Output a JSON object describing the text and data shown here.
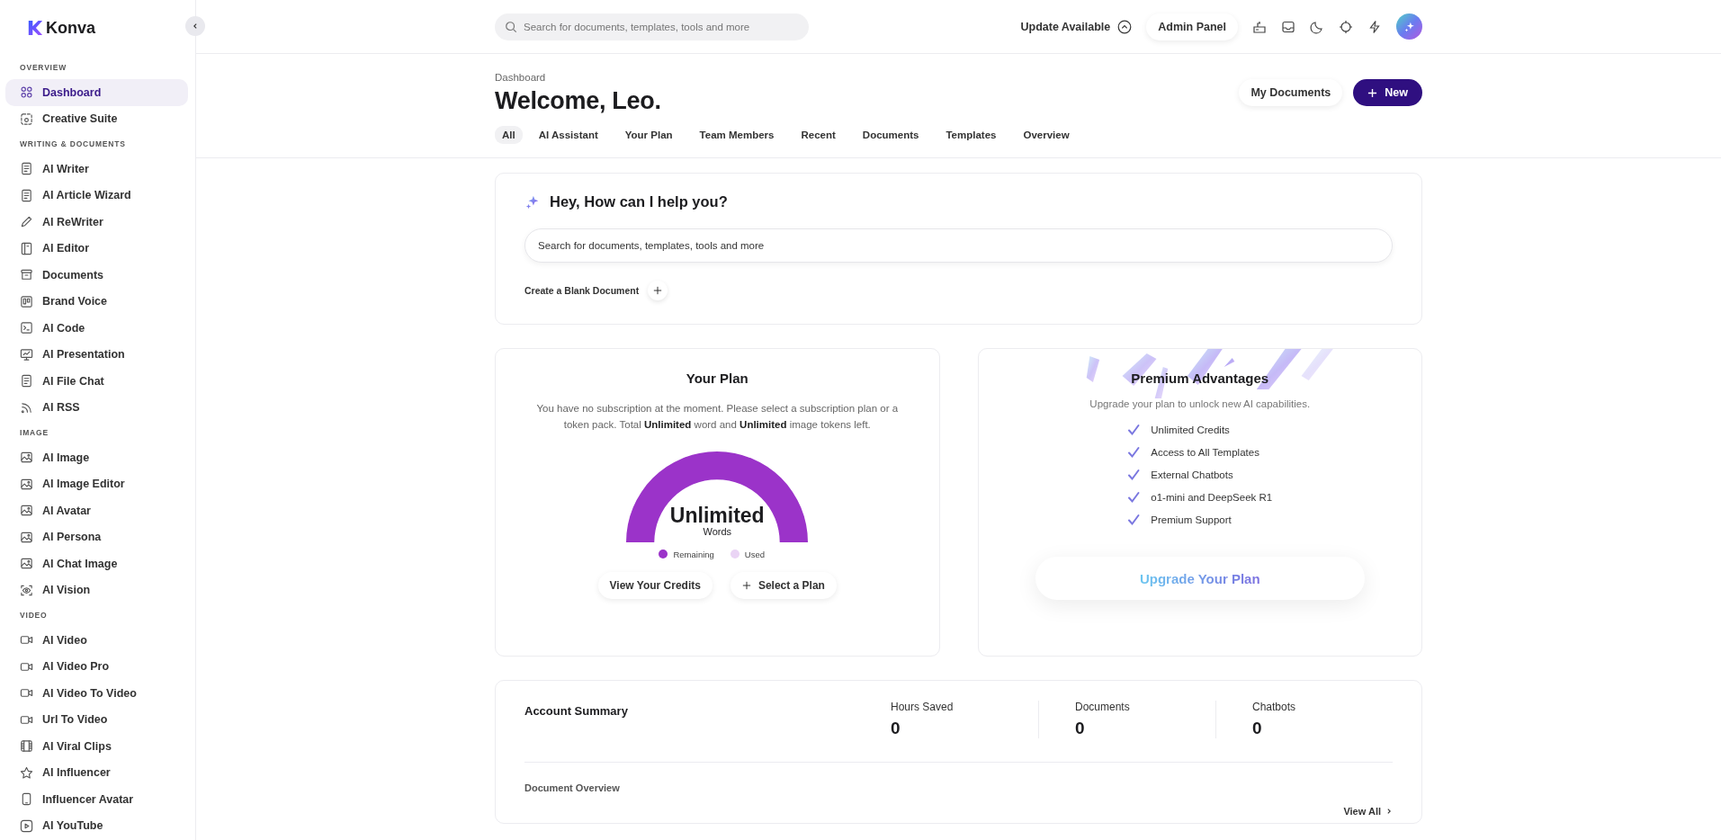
{
  "sidebar": {
    "logo": "Konva",
    "sections": [
      {
        "heading": "OVERVIEW",
        "items": [
          {
            "label": "Dashboard",
            "selected": true
          },
          {
            "label": "Creative Suite",
            "selected": false
          }
        ]
      },
      {
        "heading": "WRITING & DOCUMENTS",
        "items": [
          {
            "label": "AI Writer",
            "selected": false
          },
          {
            "label": "AI Article Wizard",
            "selected": false
          },
          {
            "label": "AI ReWriter",
            "selected": false
          },
          {
            "label": "AI Editor",
            "selected": false
          },
          {
            "label": "Documents",
            "selected": false
          },
          {
            "label": "Brand Voice",
            "selected": false
          },
          {
            "label": "AI Code",
            "selected": false
          },
          {
            "label": "AI Presentation",
            "selected": false
          },
          {
            "label": "AI File Chat",
            "selected": false
          },
          {
            "label": "AI RSS",
            "selected": false
          }
        ]
      },
      {
        "heading": "IMAGE",
        "items": [
          {
            "label": "AI Image",
            "selected": false
          },
          {
            "label": "AI Image Editor",
            "selected": false
          },
          {
            "label": "AI Avatar",
            "selected": false
          },
          {
            "label": "AI Persona",
            "selected": false
          },
          {
            "label": "AI Chat Image",
            "selected": false
          },
          {
            "label": "AI Vision",
            "selected": false
          }
        ]
      },
      {
        "heading": "VIDEO",
        "items": [
          {
            "label": "AI Video",
            "selected": false
          },
          {
            "label": "AI Video Pro",
            "selected": false
          },
          {
            "label": "AI Video To Video",
            "selected": false
          },
          {
            "label": "Url To Video",
            "selected": false
          },
          {
            "label": "AI Viral Clips",
            "selected": false
          },
          {
            "label": "AI Influencer",
            "selected": false
          },
          {
            "label": "Influencer Avatar",
            "selected": false
          },
          {
            "label": "AI YouTube",
            "selected": false
          }
        ]
      }
    ]
  },
  "topbar": {
    "search": {
      "placeholder": "Search for documents, templates, tools and more"
    },
    "update": "Update Available",
    "admin": "Admin Panel"
  },
  "header": {
    "breadcrumb": "Dashboard",
    "title": "Welcome, Leo.",
    "my_documents": "My Documents",
    "new_button": "New",
    "tabs": [
      {
        "label": "All",
        "selected": true
      },
      {
        "label": "AI Assistant",
        "selected": false
      },
      {
        "label": "Your Plan",
        "selected": false
      },
      {
        "label": "Team Members",
        "selected": false
      },
      {
        "label": "Recent",
        "selected": false
      },
      {
        "label": "Documents",
        "selected": false
      },
      {
        "label": "Templates",
        "selected": false
      },
      {
        "label": "Overview",
        "selected": false
      }
    ]
  },
  "assistant": {
    "title": "Hey, How can I help you?",
    "search": {
      "placeholder": "Search for documents, templates, tools and more"
    },
    "blank_document": "Create a Blank Document"
  },
  "plan": {
    "title": "Your Plan",
    "text": "You have no subscription at the moment. Please select a subscription plan or a token pack. Total **Unlimited** word and **Unlimited** image tokens left.",
    "gauge": {
      "value": "Unlimited",
      "unit": "Words"
    },
    "legend": [
      {
        "label": "Remaining",
        "color": "#9b33c9"
      },
      {
        "label": "Used",
        "color": "#ead4f5"
      }
    ],
    "buttons": [
      "View Your Credits",
      "Select a Plan"
    ]
  },
  "premium": {
    "title": "Premium Advantages",
    "subtitle": "Upgrade your plan to unlock new AI capabilities.",
    "features": [
      "Unlimited Credits",
      "Access to All Templates",
      "External Chatbots",
      "o1-mini and DeepSeek R1",
      "Premium Support"
    ],
    "button": "Upgrade Your Plan"
  },
  "summary": {
    "title": "Account Summary",
    "stats": [
      {
        "label": "Hours Saved",
        "value": "0"
      },
      {
        "label": "Documents",
        "value": "0"
      },
      {
        "label": "Chatbots",
        "value": "0"
      }
    ],
    "document_overview": "Document Overview",
    "view_all": "View All"
  }
}
